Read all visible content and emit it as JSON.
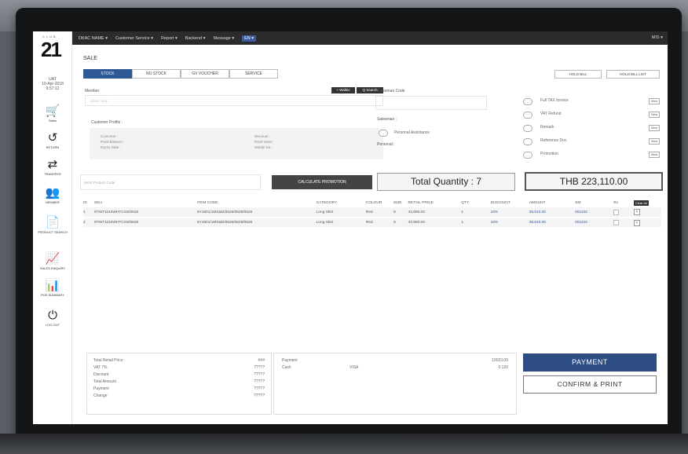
{
  "topbar": {
    "menus": [
      "DKAC NAME ▾",
      "Customer Service ▾",
      "Report ▾",
      "Backend ▾",
      "Message ▾"
    ],
    "language": "EN ▾",
    "user": "MIS ▾"
  },
  "sidebar": {
    "logo_club": "CLUB",
    "logo_number": "21",
    "date_lines": [
      "UAT",
      "10-Apr-2018",
      "9:57:12"
    ],
    "items": [
      {
        "label": "Sales",
        "icon": "cart-icon",
        "glyph": "🛒"
      },
      {
        "label": "RETURN",
        "icon": "return-icon",
        "glyph": "↺"
      },
      {
        "label": "TRANSFER",
        "icon": "transfer-icon",
        "glyph": "⇄"
      },
      {
        "label": "MEMBER",
        "icon": "member-icon",
        "glyph": "👥"
      },
      {
        "label": "PRODUCT SEARCH",
        "icon": "product-search-icon",
        "glyph": "📄"
      },
      {
        "label": "SALES ENQUIRY",
        "icon": "sales-enquiry-icon",
        "glyph": "📈"
      },
      {
        "label": "POS SUMMARY",
        "icon": "pos-summary-icon",
        "glyph": "📊"
      },
      {
        "label": "LOG OUT",
        "icon": "power-icon",
        "glyph": "⏻"
      }
    ]
  },
  "page": {
    "title": "SALE",
    "tabs": [
      "STOCK",
      "NO STOCK",
      "GV VOUCHER",
      "SERVICE"
    ],
    "hold_bill": "HOLD BILL",
    "hold_bill_list": "HOLD BILL LIST"
  },
  "member": {
    "label": "Member",
    "placeholder": "Scan / Key",
    "walkin_btn": "+ Walkin",
    "search_btn": "Q Search",
    "profile_title": "Customer Profile :",
    "fields_left": [
      "Customer :",
      "Point Balance :",
      "Expiry Date :"
    ],
    "fields_right": [
      "Discount :",
      "Point Value :",
      "Mobile No. :"
    ]
  },
  "salesman": {
    "code_label": "Salesman Code",
    "salesman_label": "Salesman :",
    "personal_assistance": "Personal Assistance",
    "personal_label": "Personal :"
  },
  "options": {
    "items": [
      "Full TAX Invoice",
      "VAT Refund",
      "Remark",
      "Reference Doc.",
      "Promotion"
    ],
    "view_label": "View"
  },
  "entry": {
    "sku_placeholder": "SKU/ Product Code",
    "calc_btn": "CALCULATE PROMOTION",
    "total_quantity": "Total Quantity : 7",
    "total_amount": "THB 223,110.00"
  },
  "table": {
    "headers": [
      "ID",
      "SKU",
      "ITEM CODE",
      "CATEGORY",
      "COLOUR",
      "SIZE",
      "RETAIL PRICE",
      "QTY",
      "DISCOUNT",
      "AMOUNT",
      "SM",
      "Rc"
    ],
    "clear_all": "Clear All",
    "rows": [
      [
        "1",
        "9TWT1154WHTCSS/0626",
        "6Y1801/1MS&D/0626/0626/0626",
        "Long Skirt",
        "Red",
        "S",
        "43,900.00",
        "1",
        "10%",
        "39,510.00",
        "001102"
      ],
      [
        "2",
        "9TWT1154WHTCSS/0626",
        "6Y1801/1MS&D/0626/0626/0626",
        "Long Skirt",
        "Red",
        "S",
        "43,900.00",
        "1",
        "10%",
        "39,510.00",
        "001102"
      ]
    ]
  },
  "summary": {
    "rows": [
      {
        "label": "Total Retail Price",
        "value": "###"
      },
      {
        "label": "VAT 7%",
        "value": "?????"
      },
      {
        "label": "Discount",
        "value": "?????"
      },
      {
        "label": "Total Amount",
        "value": "?????"
      },
      {
        "label": "Payment",
        "value": "?????"
      },
      {
        "label": "Change",
        "value": "?????"
      }
    ]
  },
  "payment": {
    "title": "Payment",
    "total": "10023.00",
    "method": "Cash",
    "card": "VISA",
    "amount": "0.120"
  },
  "actions": {
    "payment": "PAYMENT",
    "confirm_print": "CONFIRM & PRINT"
  }
}
